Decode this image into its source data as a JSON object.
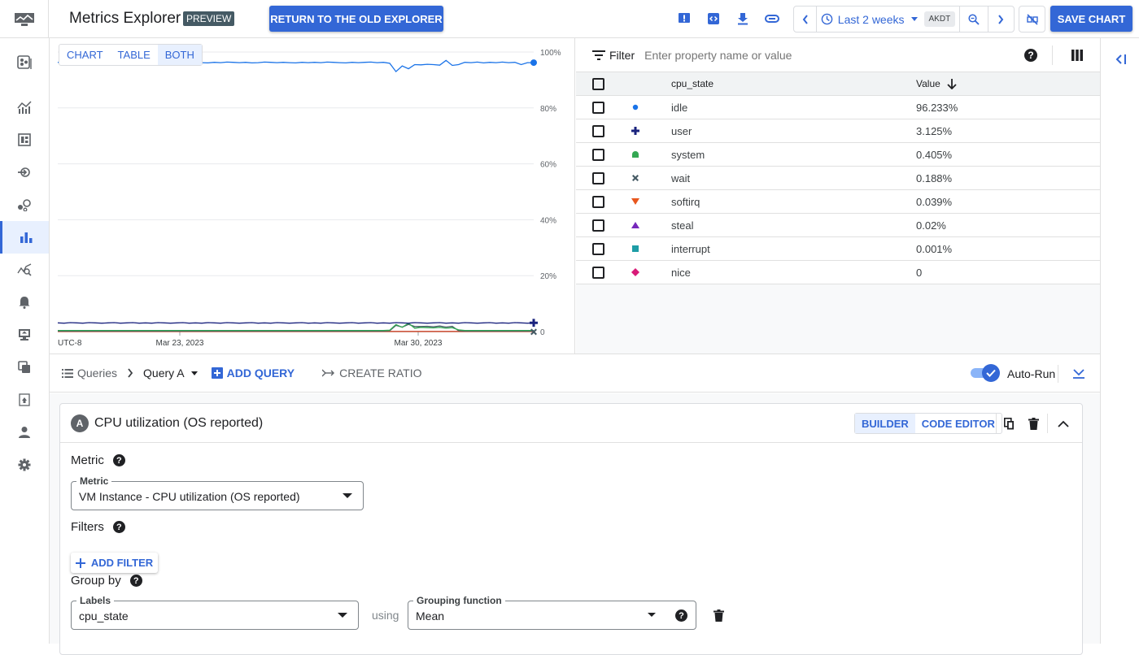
{
  "header": {
    "title": "Metrics Explorer",
    "badge": "PREVIEW",
    "return_button": "RETURN TO THE OLD EXPLORER",
    "time_range": "Last 2 weeks",
    "timezone": "AKDT",
    "save_button": "SAVE CHART",
    "icons": [
      "feedback-icon",
      "code-icon",
      "download-icon",
      "link-icon",
      "chevron-left-icon",
      "clock-icon",
      "zoom-out-icon",
      "chevron-right-icon",
      "sync-off-icon"
    ]
  },
  "sidebar": {
    "items": [
      {
        "name": "dashboard-overview",
        "active": false
      },
      {
        "name": "metrics-scope",
        "active": false
      },
      {
        "name": "dashboards",
        "active": false
      },
      {
        "name": "integrations",
        "active": false
      },
      {
        "name": "services",
        "active": false
      },
      {
        "name": "metrics-explorer",
        "active": true
      },
      {
        "name": "logs-based-metrics",
        "active": false
      },
      {
        "name": "alerting",
        "active": false
      },
      {
        "name": "uptime-checks",
        "active": false
      },
      {
        "name": "groups",
        "active": false
      },
      {
        "name": "synthetic-monitoring",
        "active": false
      },
      {
        "name": "accounts",
        "active": false
      },
      {
        "name": "settings",
        "active": false
      }
    ]
  },
  "view_toggle": {
    "options": [
      "CHART",
      "TABLE",
      "BOTH"
    ],
    "selected": "BOTH"
  },
  "chart_data": {
    "type": "line",
    "title": "",
    "xlabel": "",
    "ylabel": "",
    "timezone_label": "UTC-8",
    "x_ticks": [
      "Mar 23, 2023",
      "Mar 30, 2023"
    ],
    "y_ticks": [
      "0",
      "20%",
      "40%",
      "60%",
      "80%",
      "100%"
    ],
    "ylim": [
      0,
      100
    ],
    "grid": true,
    "series": [
      {
        "name": "idle",
        "color": "#1a73e8",
        "values": [
          96.3,
          96.2,
          96.4,
          96.1,
          96.3,
          96.2,
          96.4,
          95.8,
          96.3,
          96.2,
          96.4,
          96.3,
          96.1,
          96.3,
          96.2,
          96.4,
          96.3,
          96.2,
          96.1,
          96.3,
          96.4,
          96.2,
          96.3,
          96.2,
          96.1,
          96.3,
          96.2,
          96.4,
          96.3,
          96.2,
          96.3,
          96.1,
          96.2,
          96.4,
          96.3,
          96.2,
          96.3,
          96.2,
          96.1,
          96.3,
          96.2,
          96.3,
          96.2,
          96.4,
          96.3,
          96.2,
          96.1,
          96.3,
          96.2,
          96.3,
          96.4,
          96.2,
          96.3,
          96.0,
          93.0,
          95.0,
          94.0,
          95.5,
          95.4,
          95.6,
          95.5,
          95.3,
          97.0,
          95.2,
          95.5,
          96.3,
          96.2,
          96.4,
          96.1,
          96.3,
          96.2,
          96.4,
          96.2,
          96.3,
          95.5,
          96.2,
          96.2
        ]
      },
      {
        "name": "user",
        "color": "#1a237e",
        "values": [
          3.1,
          3.0,
          3.2,
          3.1,
          3.0,
          3.2,
          3.1,
          3.0,
          3.1,
          3.2,
          3.0,
          3.1,
          3.2,
          3.0,
          3.1,
          3.0,
          3.2,
          3.1,
          3.0,
          3.1,
          3.2,
          3.0,
          3.1,
          3.0,
          3.2,
          3.1,
          3.0,
          3.2,
          3.1,
          3.0,
          3.1,
          3.2,
          3.0,
          3.1,
          3.0,
          3.2,
          3.1,
          3.0,
          3.1,
          3.2,
          3.0,
          3.1,
          3.0,
          3.2,
          3.1,
          3.0,
          3.1,
          3.2,
          3.0,
          3.1,
          3.2,
          3.0,
          3.1,
          3.0,
          3.2,
          3.1,
          3.0,
          3.2,
          3.1,
          3.0,
          3.1,
          3.2,
          3.0,
          3.1,
          3.0,
          3.2,
          3.1,
          3.0,
          3.1,
          3.2,
          3.0,
          3.1,
          3.0,
          3.2,
          3.1,
          3.0,
          3.125
        ]
      },
      {
        "name": "system",
        "color": "#34a853",
        "values": [
          0.4,
          0.4,
          0.4,
          0.4,
          0.4,
          0.4,
          0.4,
          0.4,
          0.4,
          0.4,
          0.4,
          0.4,
          0.4,
          0.4,
          0.4,
          0.4,
          0.4,
          0.4,
          0.4,
          0.4,
          0.4,
          0.4,
          0.4,
          0.4,
          0.4,
          0.4,
          0.4,
          0.4,
          0.4,
          0.4,
          0.4,
          0.4,
          0.4,
          0.4,
          0.4,
          0.4,
          0.4,
          0.4,
          0.4,
          0.4,
          0.4,
          0.4,
          0.4,
          0.4,
          0.4,
          0.4,
          0.4,
          0.4,
          0.4,
          0.4,
          0.4,
          0.4,
          0.4,
          0.5,
          2.5,
          1.5,
          3.0,
          1.2,
          1.5,
          1.4,
          1.3,
          1.5,
          1.2,
          1.4,
          0.6,
          0.4,
          0.4,
          0.4,
          0.4,
          0.4,
          0.4,
          0.4,
          0.4,
          0.4,
          0.4,
          0.4,
          0.405
        ]
      },
      {
        "name": "wait",
        "color": "#455a64",
        "values": [
          0.2,
          0.2,
          0.2,
          0.2,
          0.2,
          0.2,
          0.2,
          0.2,
          0.2,
          0.2,
          0.2,
          0.2,
          0.2,
          0.2,
          0.2,
          0.2,
          0.2,
          0.2,
          0.2,
          0.2,
          0.2,
          0.2,
          0.2,
          0.2,
          0.2,
          0.2,
          0.2,
          0.2,
          0.2,
          0.2,
          0.2,
          0.2,
          0.2,
          0.2,
          0.2,
          0.2,
          0.2,
          0.2,
          0.2,
          0.2,
          0.2,
          0.2,
          0.2,
          0.2,
          0.2,
          0.2,
          0.2,
          0.2,
          0.2,
          0.2,
          0.2,
          0.2,
          0.2,
          0.3,
          2.2,
          1.6,
          2.6,
          1.8,
          1.8,
          1.9,
          1.7,
          2.0,
          1.6,
          1.9,
          0.3,
          0.2,
          0.2,
          0.2,
          0.2,
          0.2,
          0.2,
          0.2,
          0.2,
          0.2,
          0.2,
          0.2,
          0.188
        ]
      },
      {
        "name": "softirq",
        "color": "#e8571e",
        "values": [
          0.04,
          0.04,
          0.04,
          0.04,
          0.04,
          0.04,
          0.04,
          0.04,
          0.04,
          0.04,
          0.04,
          0.04,
          0.04,
          0.04,
          0.04,
          0.04,
          0.04,
          0.04,
          0.04,
          0.04,
          0.04,
          0.04,
          0.04,
          0.04,
          0.04,
          0.04,
          0.04,
          0.04,
          0.04,
          0.04,
          0.04,
          0.04,
          0.04,
          0.04,
          0.04,
          0.04,
          0.04,
          0.04,
          0.04,
          0.04,
          0.04,
          0.04,
          0.04,
          0.04,
          0.04,
          0.04,
          0.04,
          0.04,
          0.04,
          0.04,
          0.04,
          0.04,
          0.04,
          0.04,
          0.04,
          0.04,
          0.04,
          0.04,
          0.04,
          0.04,
          0.04,
          0.04,
          0.04,
          0.04,
          0.04,
          0.04,
          0.04,
          0.04,
          0.04,
          0.04,
          0.04,
          0.04,
          0.04,
          0.04,
          0.04,
          0.04,
          0.039
        ]
      },
      {
        "name": "steal",
        "color": "#7627bb",
        "values": [
          0.02,
          0.02,
          0.02,
          0.02,
          0.02,
          0.02,
          0.02,
          0.02,
          0.02,
          0.02,
          0.02,
          0.02,
          0.02,
          0.02,
          0.02,
          0.02,
          0.02,
          0.02,
          0.02,
          0.02,
          0.02,
          0.02,
          0.02,
          0.02,
          0.02,
          0.02,
          0.02,
          0.02,
          0.02,
          0.02,
          0.02,
          0.02,
          0.02,
          0.02,
          0.02,
          0.02,
          0.02,
          0.02,
          0.02,
          0.02,
          0.02,
          0.02,
          0.02,
          0.02,
          0.02,
          0.02,
          0.02,
          0.02,
          0.02,
          0.02,
          0.02,
          0.02,
          0.02,
          0.02,
          0.02,
          0.02,
          0.02,
          0.02,
          0.02,
          0.02,
          0.02,
          0.02,
          0.02,
          0.02,
          0.02,
          0.02,
          0.02,
          0.02,
          0.02,
          0.02,
          0.02,
          0.02,
          0.02,
          0.02,
          0.02,
          0.02,
          0.02
        ]
      },
      {
        "name": "interrupt",
        "color": "#1e9da6",
        "values": [
          0.001,
          0.001,
          0.001,
          0.001,
          0.001,
          0.001,
          0.001,
          0.001,
          0.001,
          0.001,
          0.001,
          0.001,
          0.001,
          0.001,
          0.001,
          0.001,
          0.001,
          0.001,
          0.001,
          0.001,
          0.001,
          0.001,
          0.001,
          0.001,
          0.001,
          0.001,
          0.001,
          0.001,
          0.001,
          0.001,
          0.001,
          0.001,
          0.001,
          0.001,
          0.001,
          0.001,
          0.001,
          0.001,
          0.001,
          0.001,
          0.001,
          0.001,
          0.001,
          0.001,
          0.001,
          0.001,
          0.001,
          0.001,
          0.001,
          0.001,
          0.001,
          0.001,
          0.001,
          0.001,
          0.001,
          0.001,
          0.001,
          0.001,
          0.001,
          0.001,
          0.001,
          0.001,
          0.001,
          0.001,
          0.001,
          0.001,
          0.001,
          0.001,
          0.001,
          0.001,
          0.001,
          0.001,
          0.001,
          0.001,
          0.001,
          0.001,
          0.001
        ]
      },
      {
        "name": "nice",
        "color": "#d81b78",
        "values": [
          0,
          0,
          0,
          0,
          0,
          0,
          0,
          0,
          0,
          0,
          0,
          0,
          0,
          0,
          0,
          0,
          0,
          0,
          0,
          0,
          0,
          0,
          0,
          0,
          0,
          0,
          0,
          0,
          0,
          0,
          0,
          0,
          0,
          0,
          0,
          0,
          0,
          0,
          0,
          0,
          0,
          0,
          0,
          0,
          0,
          0,
          0,
          0,
          0,
          0,
          0,
          0,
          0,
          0,
          0,
          0,
          0,
          0,
          0,
          0,
          0,
          0,
          0,
          0,
          0,
          0,
          0,
          0,
          0,
          0,
          0,
          0,
          0,
          0,
          0,
          0,
          0
        ]
      }
    ]
  },
  "table": {
    "filter_label": "Filter",
    "filter_placeholder": "Enter property name or value",
    "columns": [
      "cpu_state",
      "Value"
    ],
    "sort": "descending",
    "rows": [
      {
        "state": "idle",
        "value": "96.233%",
        "marker": "circle",
        "color": "#1a73e8"
      },
      {
        "state": "user",
        "value": "3.125%",
        "marker": "plus",
        "color": "#1a237e"
      },
      {
        "state": "system",
        "value": "0.405%",
        "marker": "dome",
        "color": "#34a853"
      },
      {
        "state": "wait",
        "value": "0.188%",
        "marker": "x",
        "color": "#455a64"
      },
      {
        "state": "softirq",
        "value": "0.039%",
        "marker": "triangle-down",
        "color": "#e8571e"
      },
      {
        "state": "steal",
        "value": "0.02%",
        "marker": "triangle-up",
        "color": "#7627bb"
      },
      {
        "state": "interrupt",
        "value": "0.001%",
        "marker": "square",
        "color": "#1e9da6"
      },
      {
        "state": "nice",
        "value": "0",
        "marker": "diamond",
        "color": "#d81b78"
      }
    ]
  },
  "querybar": {
    "queries_label": "Queries",
    "current_query": "Query A",
    "add_query": "ADD QUERY",
    "create_ratio": "CREATE RATIO",
    "autorun_label": "Auto-Run",
    "autorun_on": true
  },
  "query_card": {
    "badge": "A",
    "title": "CPU utilization (OS reported)",
    "modes": [
      "BUILDER",
      "CODE EDITOR"
    ],
    "selected_mode": "BUILDER",
    "metric_section": "Metric",
    "metric_field_label": "Metric",
    "metric_value": "VM Instance - CPU utilization (OS reported)",
    "filters_section": "Filters",
    "add_filter": "ADD FILTER",
    "groupby_section": "Group by",
    "labels_field_label": "Labels",
    "labels_value": "cpu_state",
    "using_text": "using",
    "grouping_field_label": "Grouping function",
    "grouping_value": "Mean"
  }
}
